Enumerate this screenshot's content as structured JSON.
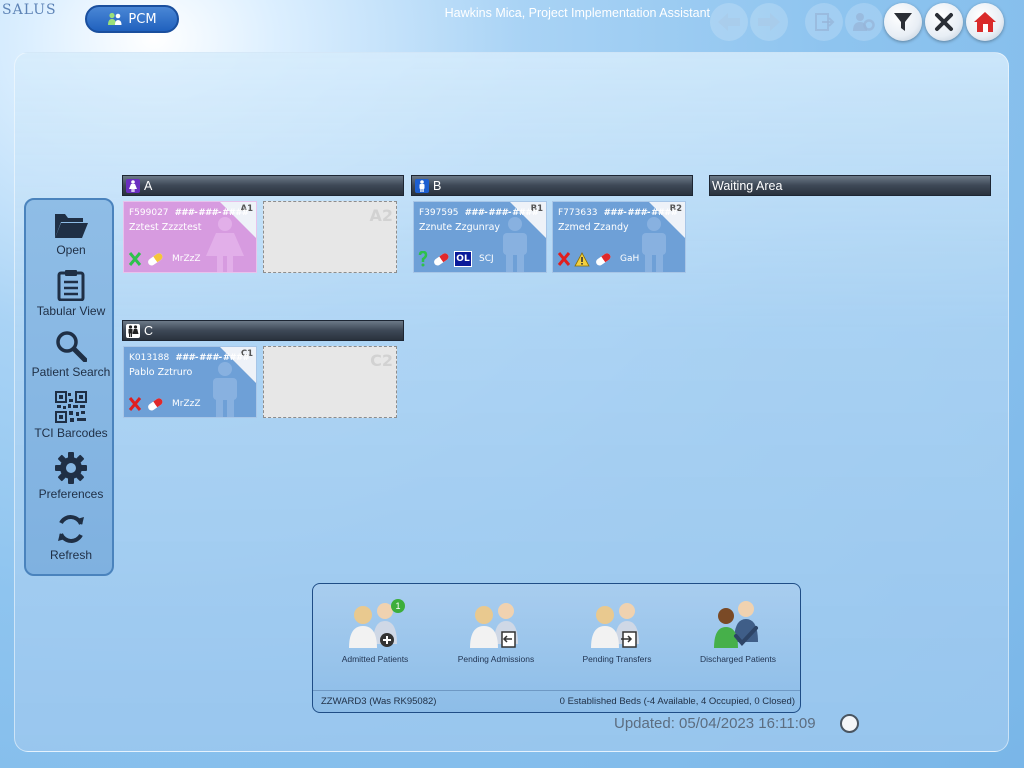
{
  "app": {
    "logo_text": "SALUS",
    "module_label": "PCM",
    "user_title": "Hawkins Mica, Project Implementation Assistant"
  },
  "toolbar": {
    "buttons": [
      {
        "name": "back",
        "icon": "arrow-left-icon",
        "enabled": false
      },
      {
        "name": "forward",
        "icon": "arrow-right-icon",
        "enabled": false
      },
      {
        "name": "logout",
        "icon": "logout-icon",
        "enabled": false
      },
      {
        "name": "settings-people",
        "icon": "people-gear-icon",
        "enabled": false
      },
      {
        "name": "filter",
        "icon": "funnel-icon",
        "enabled": true
      },
      {
        "name": "close",
        "icon": "close-icon",
        "enabled": true
      },
      {
        "name": "home",
        "icon": "home-icon",
        "enabled": true
      }
    ]
  },
  "sidebar": {
    "items": [
      {
        "label": "Open",
        "icon": "folder-open-icon"
      },
      {
        "label": "Tabular View",
        "icon": "clipboard-icon"
      },
      {
        "label": "Patient Search",
        "icon": "magnifier-icon"
      },
      {
        "label": "TCI Barcodes",
        "icon": "qr-code-icon"
      },
      {
        "label": "Preferences",
        "icon": "gear-icon"
      },
      {
        "label": "Refresh",
        "icon": "refresh-icon"
      }
    ]
  },
  "bays": [
    {
      "name": "A",
      "gender": "female"
    },
    {
      "name": "B",
      "gender": "male"
    },
    {
      "name": "Waiting Area"
    },
    {
      "name": "C",
      "gender": "mixed"
    }
  ],
  "beds": {
    "a1": {
      "id": "A1",
      "ref": "F599027",
      "mask": "###-###-####",
      "patient": "Zztest Zzzztest",
      "consultant": "MrZzZ",
      "status": "green-x",
      "gender": "female"
    },
    "a2": {
      "id": "A2"
    },
    "b1": {
      "id": "B1",
      "ref": "F397595",
      "mask": "###-###-####",
      "patient": "Zznute Zzgunray",
      "consultant": "SCJ",
      "status": "green-question",
      "badge": "OL",
      "gender": "male"
    },
    "b2": {
      "id": "B2",
      "ref": "F773633",
      "mask": "###-###-####",
      "patient": "Zzmed Zzandy",
      "consultant": "GaH",
      "status": "red-x",
      "warning": true,
      "gender": "male"
    },
    "c1": {
      "id": "C1",
      "ref": "K013188",
      "mask": "###-###-####",
      "patient": "Pablo Zztruro",
      "consultant": "MrZzZ",
      "status": "red-x",
      "gender": "male"
    },
    "c2": {
      "id": "C2"
    }
  },
  "summary": {
    "items": [
      {
        "label": "Admitted Patients",
        "count": "1",
        "icon": "admitted-patients-icon"
      },
      {
        "label": "Pending Admissions",
        "icon": "pending-admissions-icon"
      },
      {
        "label": "Pending Transfers",
        "icon": "pending-transfers-icon"
      },
      {
        "label": "Discharged Patients",
        "icon": "discharged-patients-icon"
      }
    ],
    "ward": "ZZWARD3 (Was RK95082)",
    "beds_status": "0 Established Beds (-4 Available, 4 Occupied, 0 Closed)"
  },
  "updated": "Updated: 05/04/2023 16:11:09",
  "colors": {
    "female_bed": "#d79be0",
    "male_bed": "#6ea0d7",
    "bay_header": "#3d4856",
    "accent": "#2061be"
  }
}
